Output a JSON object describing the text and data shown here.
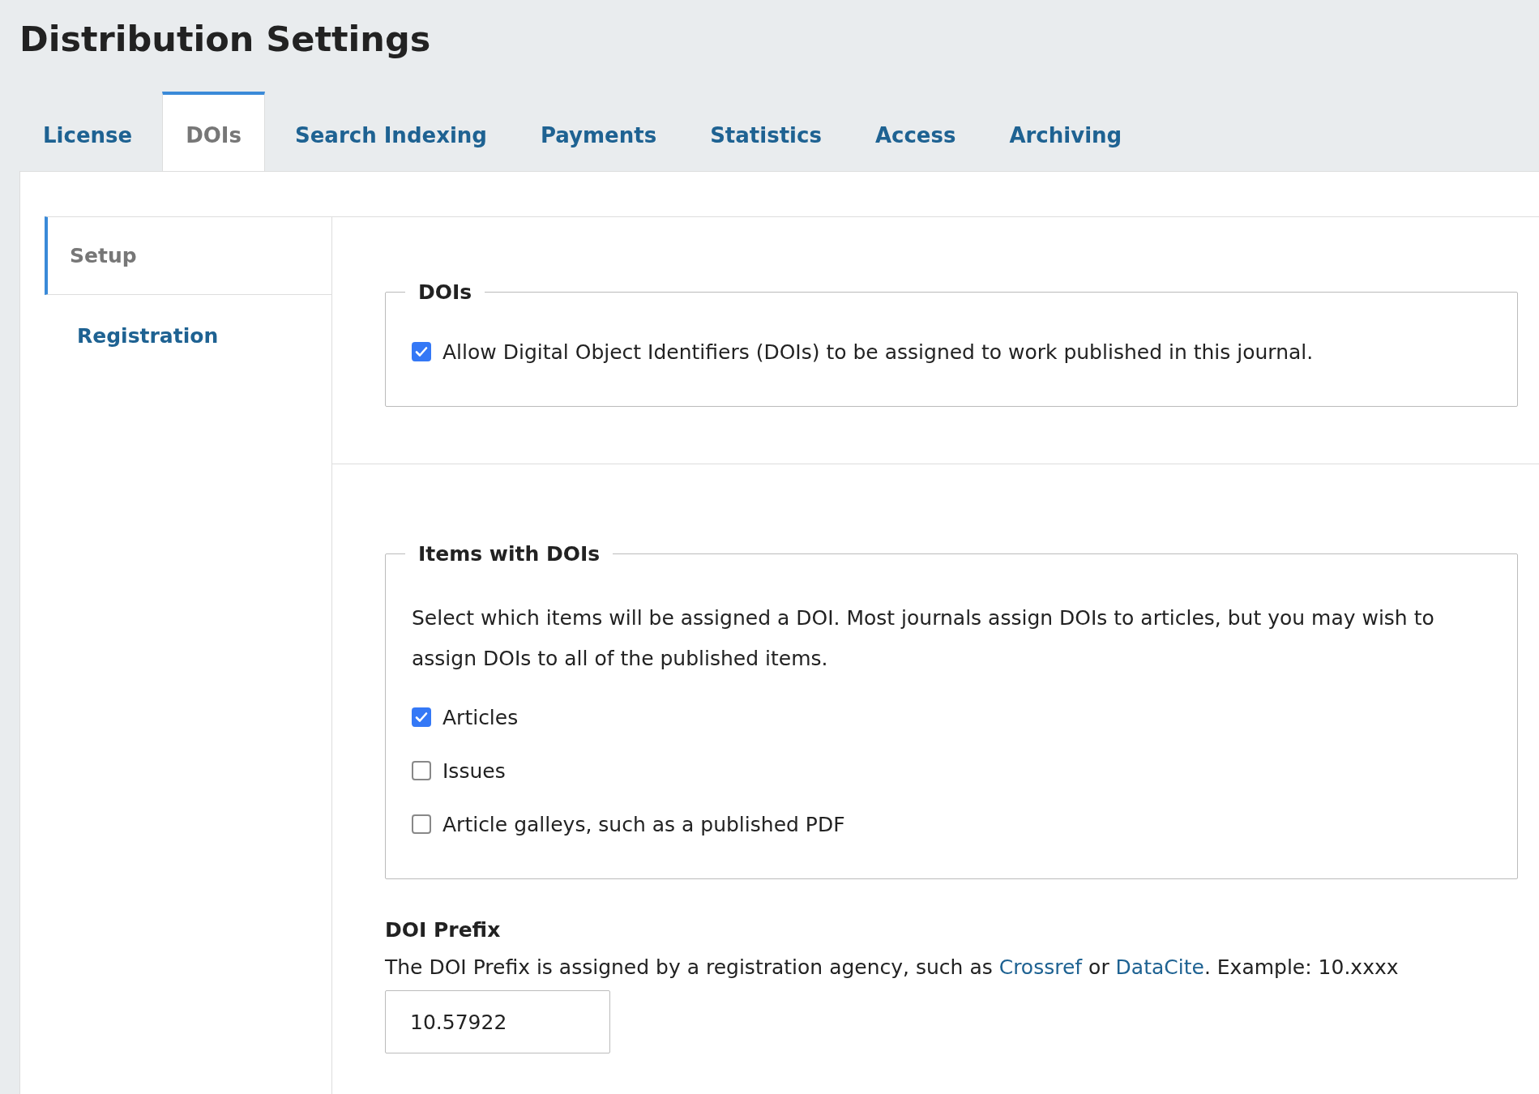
{
  "page_title": "Distribution Settings",
  "tabs": [
    {
      "label": "License",
      "selected": false
    },
    {
      "label": "DOIs",
      "selected": true
    },
    {
      "label": "Search Indexing",
      "selected": false
    },
    {
      "label": "Payments",
      "selected": false
    },
    {
      "label": "Statistics",
      "selected": false
    },
    {
      "label": "Access",
      "selected": false
    },
    {
      "label": "Archiving",
      "selected": false
    }
  ],
  "sidebar": {
    "items": [
      {
        "label": "Setup",
        "selected": true
      },
      {
        "label": "Registration",
        "selected": false
      }
    ]
  },
  "sections": [
    {
      "legend": "DOIs",
      "checkboxes": [
        {
          "label": "Allow Digital Object Identifiers (DOIs) to be assigned to work published in this journal.",
          "checked": true
        }
      ]
    },
    {
      "legend": "Items with DOIs",
      "description": "Select which items will be assigned a DOI. Most journals assign DOIs to articles, but you may wish to assign DOIs to all of the published items.",
      "checkboxes": [
        {
          "label": "Articles",
          "checked": true
        },
        {
          "label": "Issues",
          "checked": false
        },
        {
          "label": "Article galleys, such as a published PDF",
          "checked": false
        }
      ]
    }
  ],
  "doi_prefix": {
    "label": "DOI Prefix",
    "description_parts": [
      {
        "kind": "text",
        "text": "The DOI Prefix is assigned by a registration agency, such as "
      },
      {
        "kind": "link",
        "text": "Crossref"
      },
      {
        "kind": "text",
        "text": " or "
      },
      {
        "kind": "link",
        "text": "DataCite"
      },
      {
        "kind": "text",
        "text": ". Example: 10.xxxx"
      }
    ],
    "value": "10.57922"
  }
}
